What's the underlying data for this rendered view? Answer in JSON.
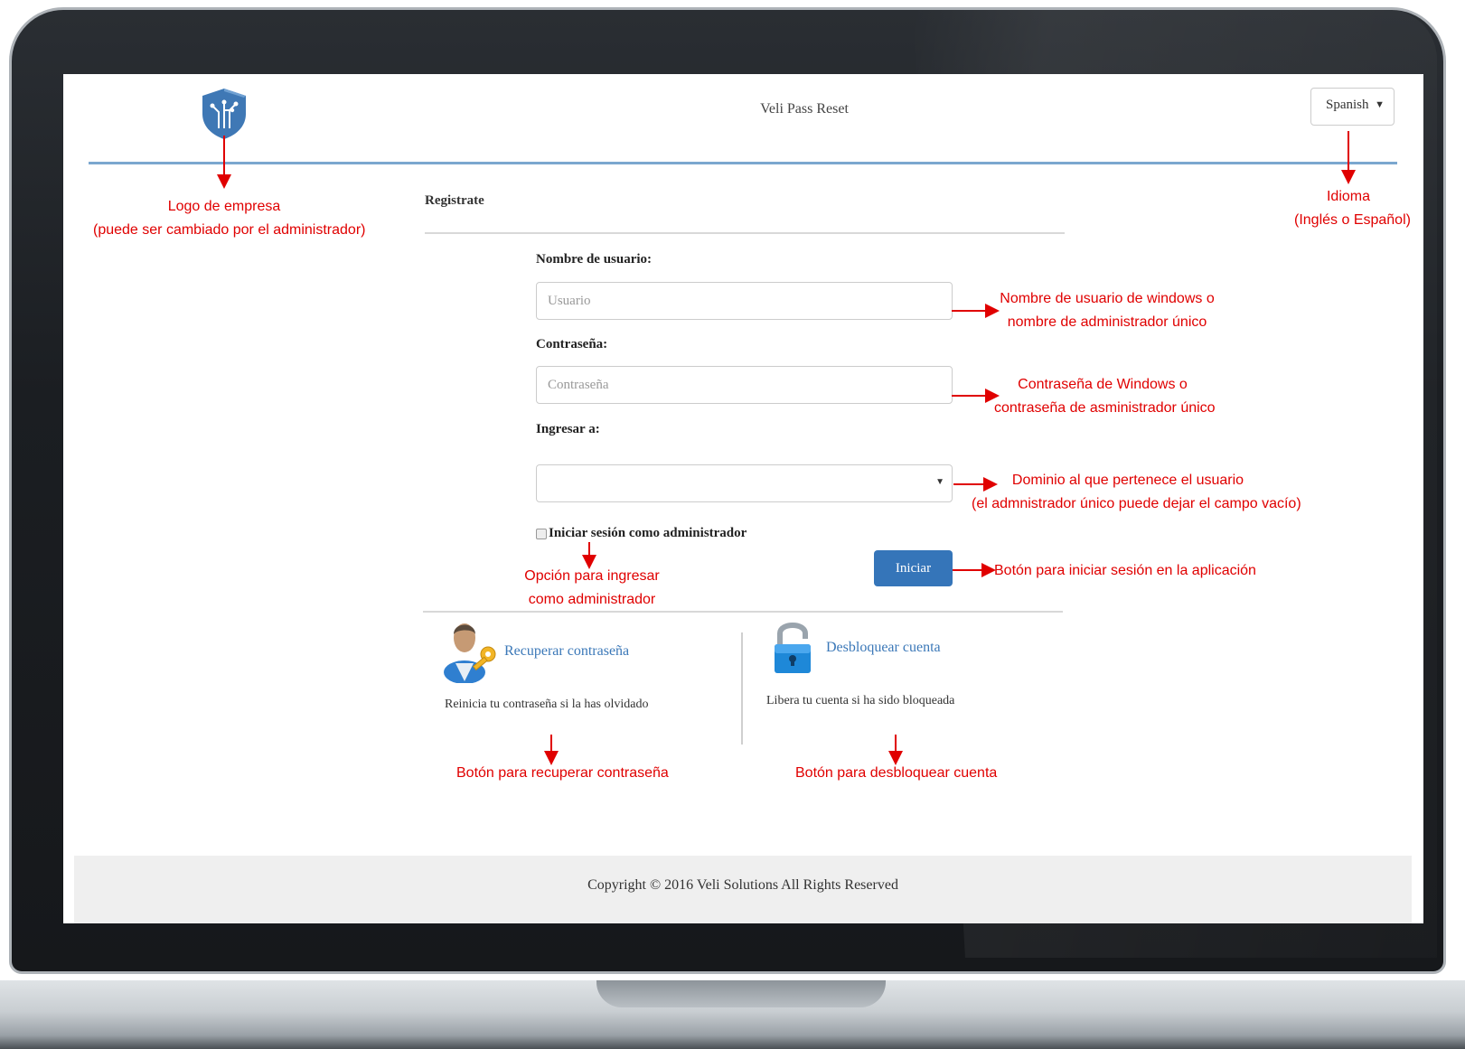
{
  "app": {
    "title": "Veli Pass Reset"
  },
  "language": {
    "selected": "Spanish"
  },
  "form": {
    "section_title": "Registrate",
    "username_label": "Nombre de usuario:",
    "username_placeholder": "Usuario",
    "password_label": "Contraseña:",
    "password_placeholder": "Contraseña",
    "domain_label": "Ingresar a:",
    "domain_value": "",
    "admin_checkbox_label": "Iniciar sesión como administrador",
    "submit_label": "Iniciar"
  },
  "actions": [
    {
      "label": "Recuperar contraseña",
      "description": "Reinicia tu contraseña si la has olvidado",
      "icon": "user-key-icon"
    },
    {
      "label": "Desbloquear cuenta",
      "description": "Libera tu cuenta si ha sido bloqueada",
      "icon": "unlock-padlock-icon"
    }
  ],
  "footer": {
    "text": "Copyright © 2016 Veli Solutions All Rights Reserved"
  },
  "annotations": {
    "logo": [
      "Logo de empresa",
      "(puede ser cambiado por el administrador)"
    ],
    "language": [
      "Idioma",
      "(Inglés o Español)"
    ],
    "username": [
      "Nombre de usuario de windows o",
      "nombre de administrador único"
    ],
    "password": [
      "Contraseña de Windows o",
      "contraseña de asministrador único"
    ],
    "domain": [
      "Dominio al que pertenece el usuario",
      "(el admnistrador único puede dejar el campo vacío)"
    ],
    "admin_option": [
      "Opción para ingresar",
      "como administrador"
    ],
    "submit": "Botón para iniciar sesión en la aplicación",
    "recover": "Botón para recuperar contraseña",
    "unlock": "Botón para desbloquear cuenta"
  },
  "colors": {
    "accent": "#3575b9",
    "header_line": "#7ba7cf",
    "annotation": "#e00000"
  }
}
